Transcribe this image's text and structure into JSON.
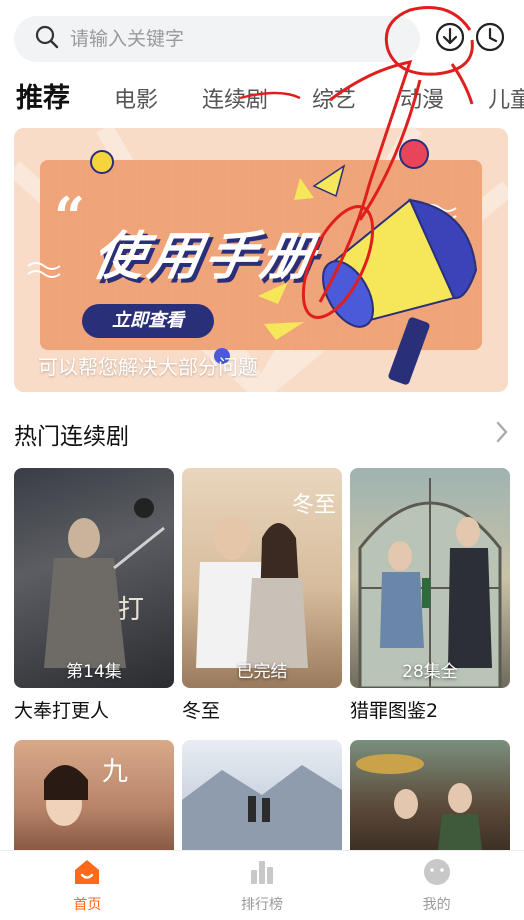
{
  "search": {
    "placeholder": "请输入关键字"
  },
  "header_icons": {
    "download": "download-icon",
    "history": "clock-icon"
  },
  "tabs": [
    {
      "label": "推荐"
    },
    {
      "label": "电影"
    },
    {
      "label": "连续剧"
    },
    {
      "label": "综艺"
    },
    {
      "label": "动漫"
    },
    {
      "label": "儿童"
    }
  ],
  "banner": {
    "headline": "使用手册",
    "button_label": "立即查看",
    "caption": "可以帮您解决大部分问题",
    "colors": {
      "bg": "#f7d8c3",
      "panel": "#f0a47a",
      "button": "#2a2f7a",
      "megaphone": "#f5e65a"
    }
  },
  "section": {
    "title": "热门连续剧"
  },
  "posters": [
    {
      "title": "大奉打更人",
      "badge": "第14集"
    },
    {
      "title": "冬至",
      "badge": "已完结"
    },
    {
      "title": "猎罪图鉴2",
      "badge": "28集全"
    }
  ],
  "bottom_nav": [
    {
      "label": "首页",
      "icon": "home-icon",
      "active": true
    },
    {
      "label": "排行榜",
      "icon": "bar-chart-icon",
      "active": false
    },
    {
      "label": "我的",
      "icon": "profile-icon",
      "active": false
    }
  ],
  "accent": "#ff6a1a"
}
